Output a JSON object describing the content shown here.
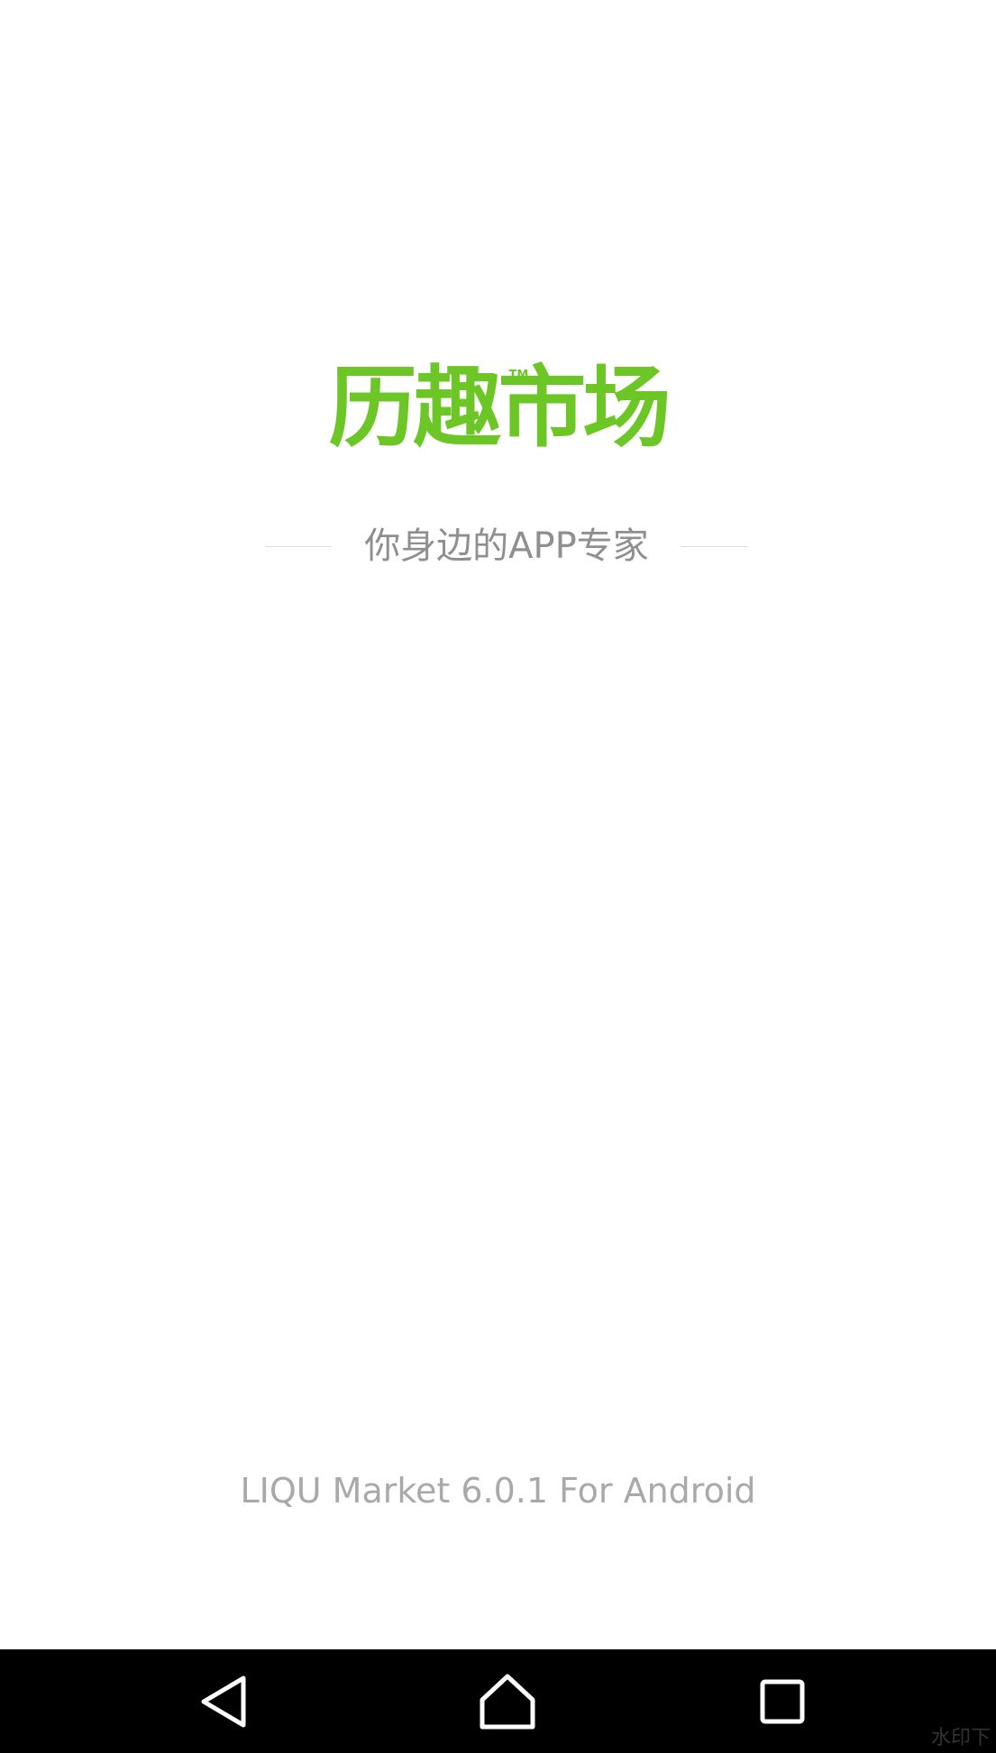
{
  "splash": {
    "logo_text": "历趣市场",
    "logo_trademark": "TM",
    "tagline": "你身边的APP专家",
    "version_text": "LIQU Market 6.0.1 For Android",
    "brand_color": "#6cc726",
    "text_color": "#8f8f8f"
  },
  "navbar": {
    "background": "#000000",
    "buttons": [
      {
        "name": "back",
        "icon": "back-triangle-icon"
      },
      {
        "name": "home",
        "icon": "home-icon"
      },
      {
        "name": "recents",
        "icon": "recents-square-icon"
      }
    ]
  },
  "watermark": {
    "text": "水印下"
  }
}
